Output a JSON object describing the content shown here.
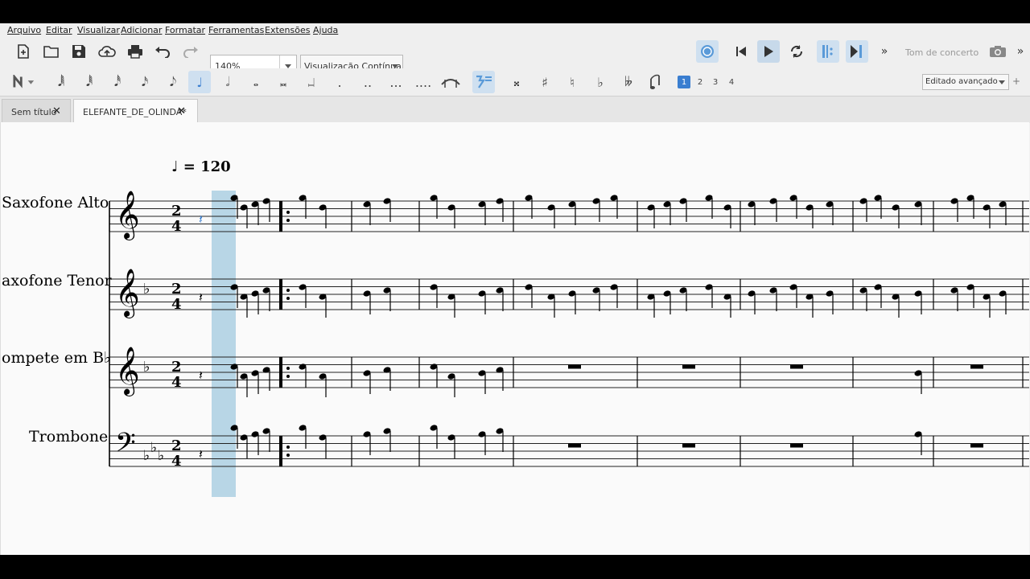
{
  "menu": [
    "Arquivo",
    "Editar",
    "Visualizar",
    "Adicionar",
    "Formatar",
    "Ferramentas",
    "Extensões",
    "Ajuda"
  ],
  "toolbar": {
    "zoom_value": "140%",
    "view_mode": "Visualização Contínua",
    "concert_pitch": "Tom de concerto",
    "more": "»"
  },
  "note_input": {
    "durations": [
      "𝅘𝅥𝅲",
      "𝅘𝅥𝅱",
      "𝅘𝅥𝅰",
      "𝅘𝅥𝅯",
      "𝅘𝅥𝅮",
      "♩",
      "𝅗𝅥",
      "𝅝",
      "𝅜",
      "𝆶"
    ],
    "dots": [
      ".",
      "..",
      "...",
      "...."
    ],
    "accidentals": [
      "𝄪",
      "♯",
      "♮",
      "♭",
      "𝄫"
    ],
    "voices": [
      "1",
      "2",
      "3",
      "4"
    ],
    "workspace": "Editado avançado",
    "add": "+"
  },
  "tabs": [
    {
      "label": "Sem título",
      "close": "✕"
    },
    {
      "label": "ELEFANTE_DE_OLINDA*",
      "close": "✕"
    }
  ],
  "score": {
    "tempo": "♩ = 120",
    "instruments": [
      "Saxofone Alto",
      "axofone Tenor",
      "ompete em B♭",
      "Trombone"
    ]
  },
  "colors": {
    "accent": "#3a7ed0",
    "selection": "#b8d6e6",
    "score_bg": "#fafafa"
  }
}
